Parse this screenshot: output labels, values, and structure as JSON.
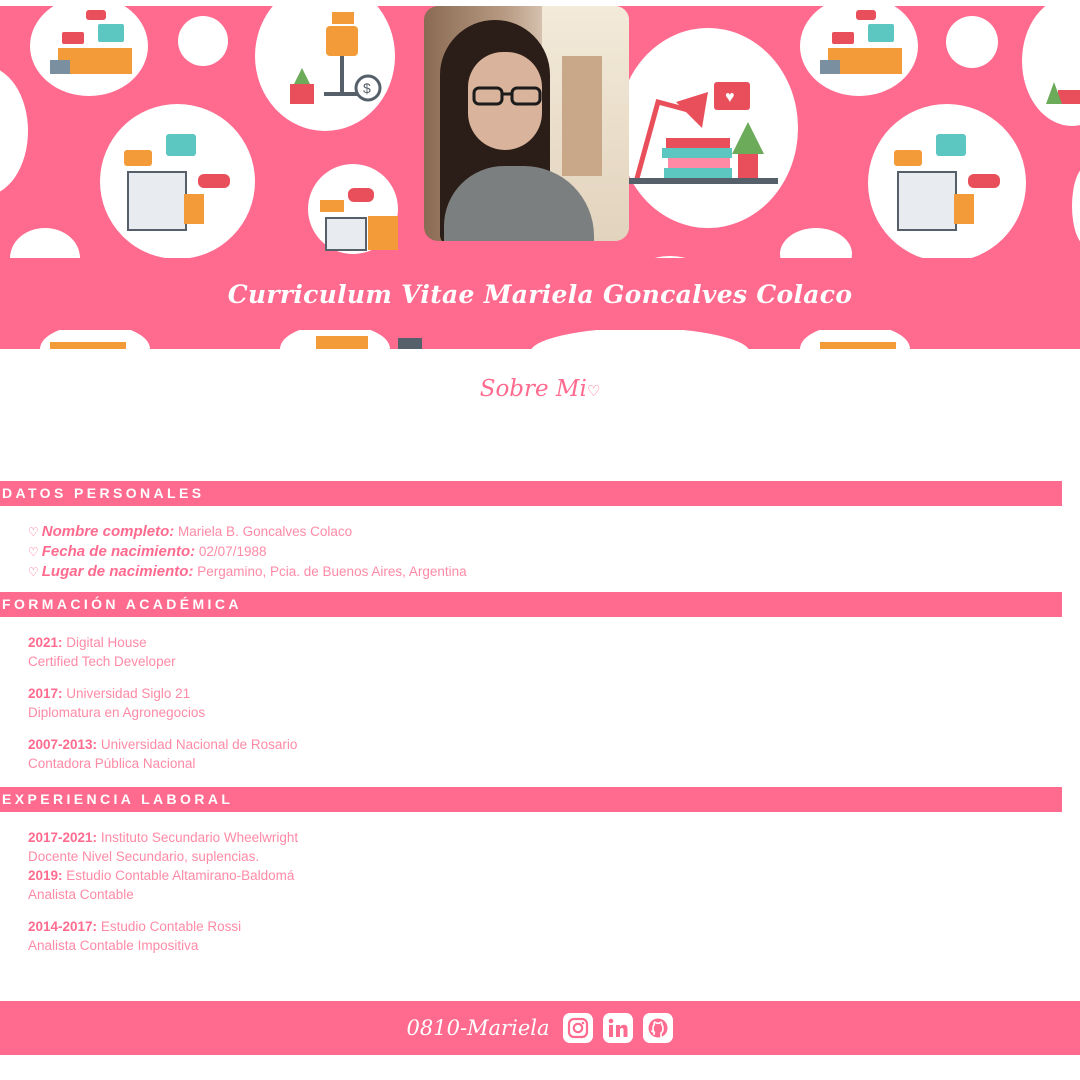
{
  "header": {
    "title": "Curriculum Vitae Mariela Goncalves Colaco",
    "photo_alt": "Foto de perfil"
  },
  "about": {
    "title": "Sobre Mi",
    "icon": "heart-icon"
  },
  "personal": {
    "heading": "DATOS PERSONALES",
    "items": [
      {
        "label": "Nombre completo:",
        "value": "Mariela B. Goncalves Colaco"
      },
      {
        "label": "Fecha de nacimiento:",
        "value": "02/07/1988"
      },
      {
        "label": "Lugar de nacimiento:",
        "value": "Pergamino, Pcia. de Buenos Aires, Argentina"
      }
    ]
  },
  "education": {
    "heading": "FORMACIÓN ACADÉMICA",
    "items": [
      {
        "year": "2021:",
        "place": "Digital House",
        "detail": "Certified Tech Developer"
      },
      {
        "year": "2017:",
        "place": "Universidad Siglo 21",
        "detail": "Diplomatura en Agronegocios"
      },
      {
        "year": "2007-2013:",
        "place": "Universidad Nacional de Rosario",
        "detail": "Contadora Pública Nacional"
      }
    ]
  },
  "experience": {
    "heading": "EXPERIENCIA LABORAL",
    "items": [
      {
        "year": "2017-2021:",
        "place": "Instituto Secundario Wheelwright",
        "detail": "Docente Nivel Secundario, suplencias."
      },
      {
        "year": "2019:",
        "place": "Estudio Contable Altamirano-Baldomá",
        "detail": "Analista Contable"
      },
      {
        "year": "2014-2017:",
        "place": "Estudio Contable Rossi",
        "detail": "Analista Contable Impositiva"
      }
    ]
  },
  "footer": {
    "name": "0810-Mariela",
    "icons": [
      "instagram-icon",
      "linkedin-icon",
      "github-icon"
    ]
  },
  "colors": {
    "accent": "#ff6b8f",
    "background": "#ffffff"
  }
}
